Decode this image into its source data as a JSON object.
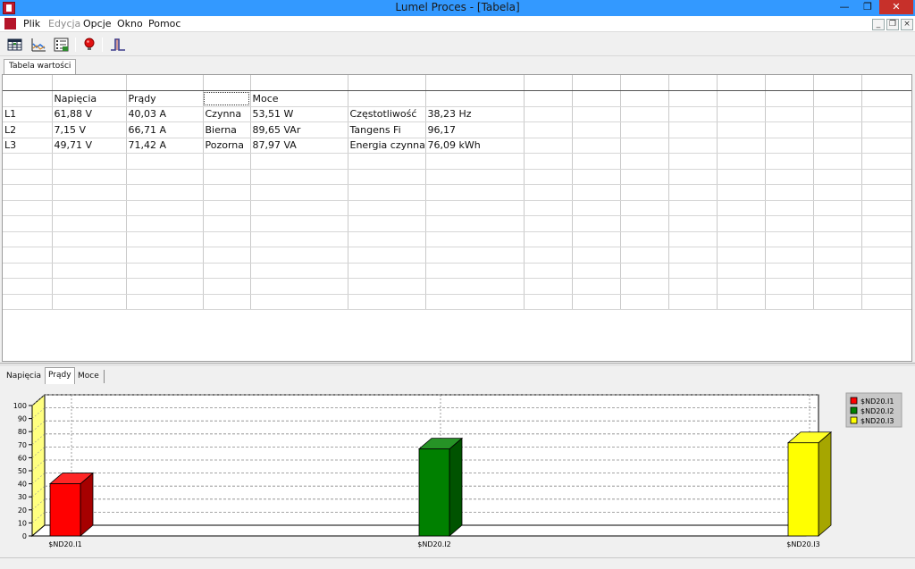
{
  "window": {
    "title": "Lumel Proces - [Tabela]",
    "min_glyph": "—",
    "max_glyph": "❐",
    "close_glyph": "✕"
  },
  "menu": {
    "items": [
      {
        "label": "Plik",
        "enabled": true
      },
      {
        "label": "Edycja",
        "enabled": false
      },
      {
        "label": "Opcje",
        "enabled": true
      },
      {
        "label": "Okno",
        "enabled": true
      },
      {
        "label": "Pomoc",
        "enabled": true
      }
    ],
    "mdi_min": "_",
    "mdi_restore": "❐",
    "mdi_close": "×"
  },
  "toolbar": {
    "icons": [
      "table-view-icon",
      "chart-view-icon",
      "settings-list-icon",
      "alarm-bulb-icon",
      "signal-impulse-icon"
    ]
  },
  "tabs_top": [
    {
      "label": "Tabela wartości",
      "active": true
    }
  ],
  "grid": {
    "header": [
      "Napięcia",
      "Prądy",
      "",
      "Moce",
      "",
      "",
      "",
      "",
      "",
      "",
      "",
      "",
      "",
      ""
    ],
    "rows": [
      [
        "L1",
        "61,88 V",
        "40,03 A",
        "Czynna",
        "53,51 W",
        "Częstotliwość",
        "38,23 Hz",
        "",
        "",
        "",
        "",
        "",
        "",
        "",
        ""
      ],
      [
        "L2",
        "7,15 V",
        "66,71 A",
        "Bierna",
        "89,65 VAr",
        "Tangens Fi",
        "96,17",
        "",
        "",
        "",
        "",
        "",
        "",
        "",
        ""
      ],
      [
        "L3",
        "49,71 V",
        "71,42 A",
        "Pozorna",
        "87,97 VA",
        "Energia czynna",
        "76,09 kWh",
        "",
        "",
        "",
        "",
        "",
        "",
        "",
        ""
      ]
    ]
  },
  "bottom_tabs": [
    {
      "label": "Napięcia",
      "active": false
    },
    {
      "label": "Prądy",
      "active": true
    },
    {
      "label": "Moce",
      "active": false
    }
  ],
  "chart_data": {
    "type": "bar",
    "categories": [
      "$ND20.I1",
      "$ND20.I2",
      "$ND20.I3"
    ],
    "series": [
      {
        "name": "$ND20.I1",
        "values": [
          40.03
        ],
        "color": "#ff0000"
      },
      {
        "name": "$ND20.I2",
        "values": [
          66.71
        ],
        "color": "#008000"
      },
      {
        "name": "$ND20.I3",
        "values": [
          71.42
        ],
        "color": "#ffff00"
      }
    ],
    "ylim": [
      0,
      100
    ],
    "yticks": [
      0,
      10,
      20,
      30,
      40,
      50,
      60,
      70,
      80,
      90,
      100
    ],
    "grid": true,
    "legend": "top-right",
    "three_d": true
  }
}
